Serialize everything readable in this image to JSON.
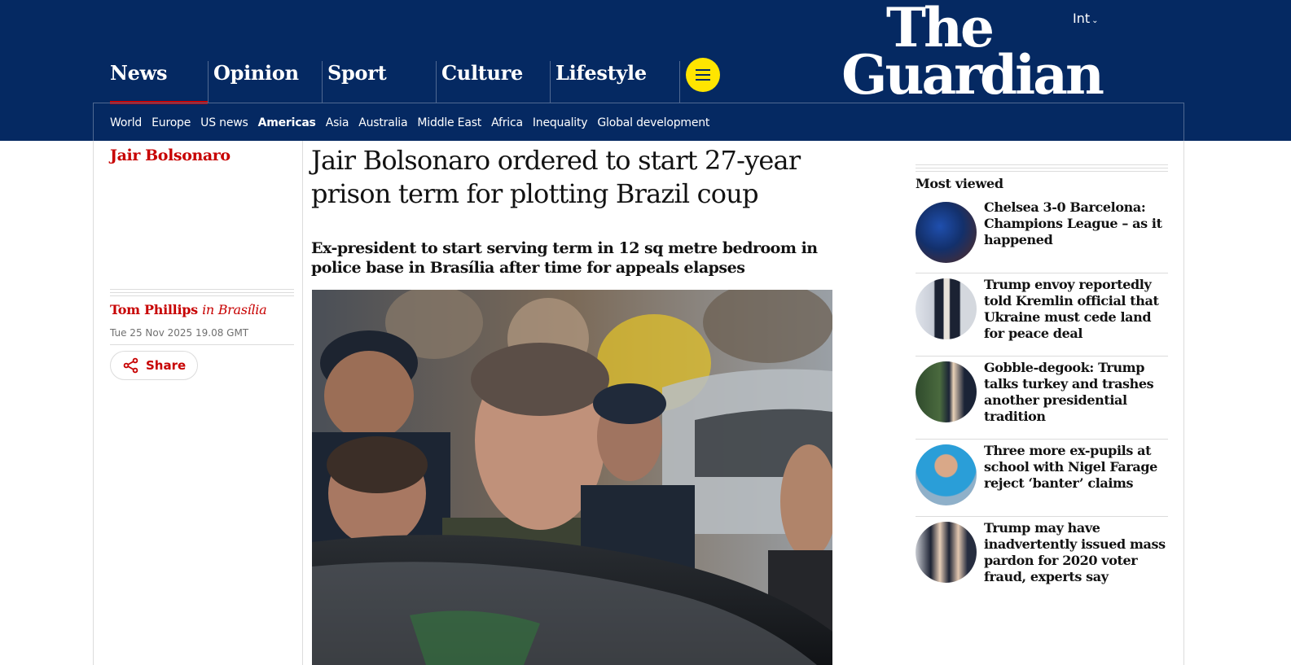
{
  "header": {
    "pillars": [
      {
        "label": "News"
      },
      {
        "label": "Opinion"
      },
      {
        "label": "Sport"
      },
      {
        "label": "Culture"
      },
      {
        "label": "Lifestyle"
      }
    ],
    "edition": "Int",
    "logo_line1": "The",
    "logo_line2": "Guardian",
    "menu_icon": "hamburger-icon",
    "colors": {
      "brand": "#052962",
      "menu": "#ffe500",
      "news": "#c70000"
    }
  },
  "subnav": {
    "items": [
      "World",
      "Europe",
      "US news",
      "Americas",
      "Asia",
      "Australia",
      "Middle East",
      "Africa",
      "Inequality",
      "Global development"
    ],
    "active": "Americas"
  },
  "article": {
    "series": "Jair Bolsonaro",
    "headline": "Jair Bolsonaro ordered to start 27-year prison term for plotting Brazil coup",
    "standfirst": "Ex-president to start serving term in 12 sq metre bedroom in police base in Brasília after time for appeals elapses",
    "author": "Tom Phillips",
    "location": "in Brasília",
    "date": "Tue 25 Nov 2025 19.08 GMT",
    "share_label": "Share",
    "share_icon": "share-icon"
  },
  "most_viewed": {
    "title": "Most viewed",
    "items": [
      {
        "title": "Chelsea 3-0 Barcelona: Champions League – as it happened"
      },
      {
        "title": "Trump envoy reportedly told Kremlin official that Ukraine must cede land for peace deal"
      },
      {
        "title": "Gobble-degook: Trump talks turkey and trashes another presidential tradition"
      },
      {
        "title": "Three more ex-pupils at school with Nigel Farage reject ‘banter’ claims"
      },
      {
        "title": "Trump may have inadvertently issued mass pardon for 2020 voter fraud, experts say"
      }
    ]
  }
}
